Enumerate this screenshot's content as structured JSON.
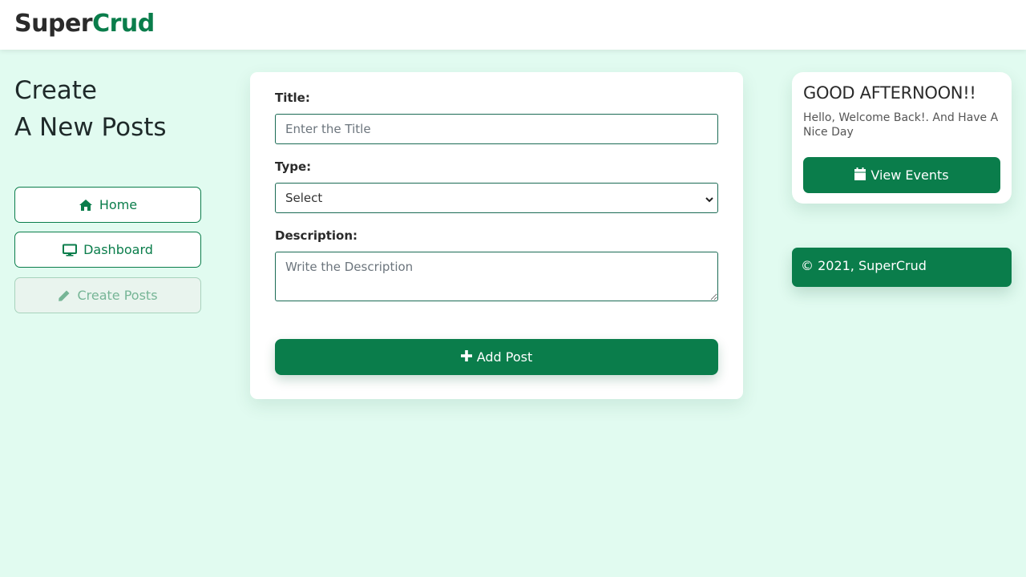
{
  "brand": {
    "part1": "Super",
    "part2": "Crud"
  },
  "left": {
    "heading_line1": "Create",
    "heading_line2": "A New Posts",
    "nav": [
      {
        "label": "Home",
        "icon": "home-icon"
      },
      {
        "label": "Dashboard",
        "icon": "monitor-icon"
      },
      {
        "label": "Create Posts",
        "icon": "pencil-icon",
        "active": true
      }
    ]
  },
  "form": {
    "title_label": "Title:",
    "title_placeholder": "Enter the Title",
    "title_value": "",
    "type_label": "Type:",
    "type_selected": "Select",
    "description_label": "Description:",
    "description_placeholder": "Write the Description",
    "description_value": "",
    "submit_label": "Add Post"
  },
  "greeting": {
    "title": "GOOD AFTERNOON!!",
    "message": "Hello, Welcome Back!. And Have A Nice Day",
    "button_label": "View Events"
  },
  "footer": {
    "text": "© 2021, SuperCrud"
  },
  "colors": {
    "accent": "#0a7d4b",
    "background": "#e1fbf0",
    "card": "#ffffff"
  }
}
